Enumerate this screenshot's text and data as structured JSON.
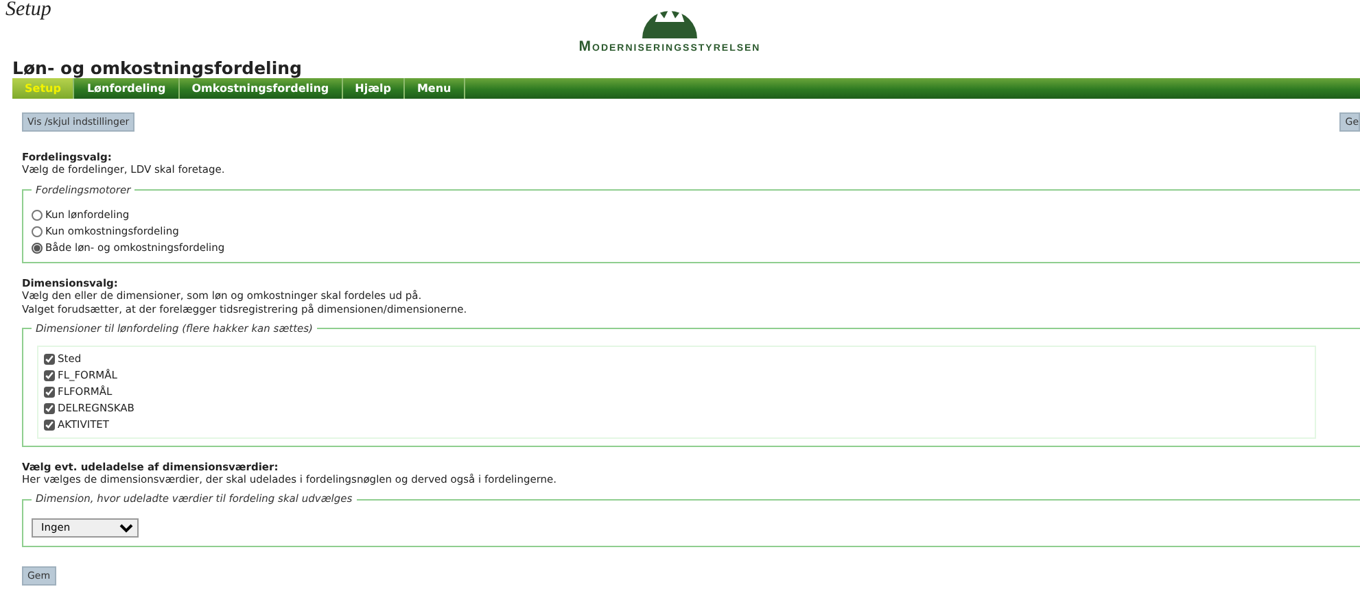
{
  "page_heading": "Setup",
  "logo": {
    "text": "Moderniseringsstyrelsen"
  },
  "app_title": "Løn- og omkostningsfordeling",
  "tabs": [
    {
      "label": "Setup",
      "selected": true
    },
    {
      "label": "Lønfordeling",
      "selected": false
    },
    {
      "label": "Omkostningsfordeling",
      "selected": false
    },
    {
      "label": "Hjælp",
      "selected": false
    },
    {
      "label": "Menu",
      "selected": false
    }
  ],
  "toggle_button": "Vis /skjul indstillinger",
  "top_save_button": "Ge",
  "distribution_choice": {
    "heading": "Fordelingsvalg:",
    "description": [
      "Vælg de fordelinger, LDV skal foretage."
    ],
    "fieldset": {
      "legend": "Fordelingsmotorer",
      "options": [
        {
          "label": "Kun lønfordeling",
          "selected": false
        },
        {
          "label": "Kun omkostningsfordeling",
          "selected": false
        },
        {
          "label": "Både løn- og omkostningsfordeling",
          "selected": true
        }
      ]
    }
  },
  "dimension_choice": {
    "heading": "Dimensionsvalg:",
    "description": [
      "Vælg den eller de dimensioner, som løn og omkostninger skal fordeles ud på.",
      "Valget forudsætter, at der forelægger tidsregistrering på dimensionen/dimensionerne."
    ],
    "fieldset": {
      "legend": "Dimensioner til lønfordeling (flere hakker kan sættes)",
      "options": [
        {
          "label": "Sted",
          "checked": true
        },
        {
          "label": "FL_FORMÅL",
          "checked": true
        },
        {
          "label": "FLFORMÅL",
          "checked": true
        },
        {
          "label": "DELREGNSKAB",
          "checked": true
        },
        {
          "label": "AKTIVITET",
          "checked": true
        }
      ]
    }
  },
  "exclusion_choice": {
    "heading": "Vælg evt. udeladelse af dimensionsværdier:",
    "description": [
      "Her vælges de dimensionsværdier, der skal udelades i fordelingsnøglen og derved også i fordelingerne."
    ],
    "fieldset": {
      "legend": "Dimension, hvor udeladte værdier til fordeling skal udvælges",
      "select_value": "Ingen"
    }
  },
  "save_button": "Gem"
}
